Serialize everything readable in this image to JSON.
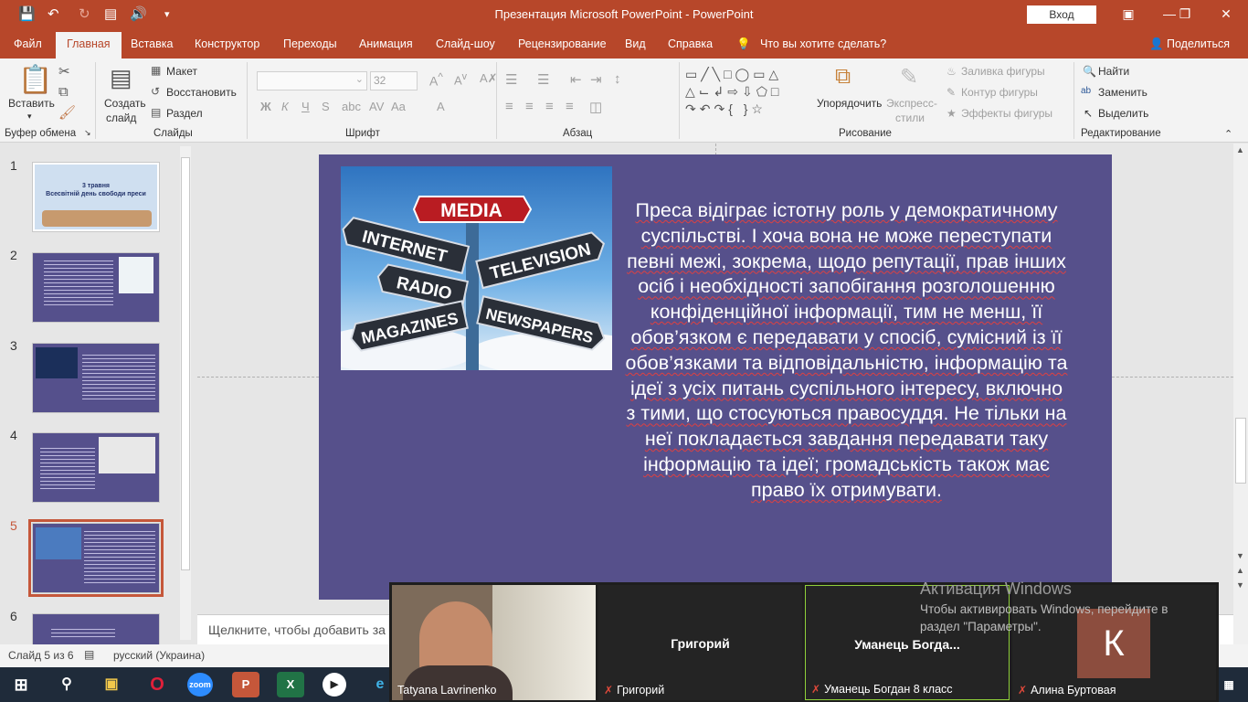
{
  "titlebar": {
    "title": "Презентация Microsoft PowerPoint  -  PowerPoint",
    "signin": "Вход"
  },
  "tabs": [
    "Файл",
    "Главная",
    "Вставка",
    "Конструктор",
    "Переходы",
    "Анимация",
    "Слайд-шоу",
    "Рецензирование",
    "Вид",
    "Справка"
  ],
  "tell_me": "Что вы хотите сделать?",
  "share": "Поделиться",
  "ribbon": {
    "clipboard": {
      "paste": "Вставить",
      "label": "Буфер обмена"
    },
    "slides": {
      "new_slide_1": "Создать",
      "new_slide_2": "слайд",
      "layout": "Макет",
      "reset": "Восстановить",
      "section": "Раздел",
      "label": "Слайды"
    },
    "font": {
      "size": "32",
      "bold": "Ж",
      "italic": "К",
      "underline": "Ч",
      "strike": "S",
      "label": "Шрифт"
    },
    "paragraph": {
      "label": "Абзац"
    },
    "drawing": {
      "arrange": "Упорядочить",
      "styles_1": "Экспресс-",
      "styles_2": "стили",
      "fill": "Заливка фигуры",
      "outline": "Контур фигуры",
      "effects": "Эффекты фигуры",
      "label": "Рисование"
    },
    "editing": {
      "find": "Найти",
      "replace": "Заменить",
      "select": "Выделить",
      "label": "Редактирование"
    }
  },
  "thumbnails": [
    {
      "num": "1",
      "title_line1": "3 травня",
      "title_line2": "Всесвітній день свободи преси"
    },
    {
      "num": "2"
    },
    {
      "num": "3"
    },
    {
      "num": "4"
    },
    {
      "num": "5"
    },
    {
      "num": "6"
    }
  ],
  "slide": {
    "image_signs": [
      "MEDIA",
      "INTERNET",
      "TELEVISION",
      "RADIO",
      "MAGAZINES",
      "NEWSPAPERS"
    ],
    "text": "Преса відіграє істотну роль у демократичному суспільстві. І хоча вона не може переступати певні межі, зокрема, щодо репутації, прав інших осіб і необхідності запобігання розголошенню конфіденційної інформації, тим не менш, її обов’язком є передавати у спосіб, сумісний із її обов’язками та відповідальністю, інформацію та ідеї з усіх питань суспільного інтересу, включно з тими, що стосуються правосуддя. Не тільки на неї покладається завдання передавати таку інформацію та ідеї; громадськість також має право їх отримувати."
  },
  "notes_placeholder": "Щелкните, чтобы добавить за",
  "status": {
    "slide_of": "Слайд 5 из 6",
    "language": "русский (Украина)"
  },
  "meeting": {
    "tiles": [
      {
        "name": "Tatyana Lavrinenko"
      },
      {
        "name": "Григорий",
        "center": "Григорий"
      },
      {
        "name": "Уманець Богдан 8 класс",
        "center": "Уманець  Богда..."
      },
      {
        "name": "Алина Буртовая",
        "avatar_letter": "К"
      }
    ]
  },
  "activation": {
    "title": "Активация Windows",
    "line1": "Чтобы активировать Windows, перейдите в",
    "line2": "раздел \"Параметры\"."
  },
  "colors": {
    "accent": "#b7472a",
    "slide_bg": "#56508b"
  }
}
